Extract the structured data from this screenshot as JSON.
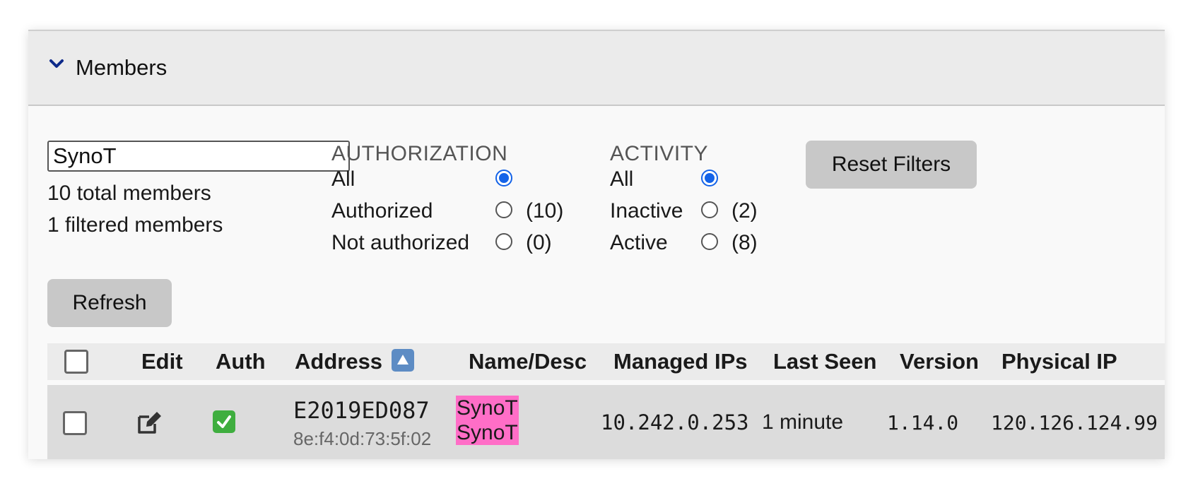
{
  "section": {
    "title": "Members"
  },
  "filter": {
    "value": "SynoT",
    "total_label": "10 total members",
    "filtered_label": "1 filtered members"
  },
  "authorization": {
    "heading": "AUTHORIZATION",
    "options": [
      {
        "label": "All",
        "count": "",
        "selected": true
      },
      {
        "label": "Authorized",
        "count": "(10)",
        "selected": false
      },
      {
        "label": "Not authorized",
        "count": "(0)",
        "selected": false
      }
    ]
  },
  "activity": {
    "heading": "ACTIVITY",
    "options": [
      {
        "label": "All",
        "count": "",
        "selected": true
      },
      {
        "label": "Inactive",
        "count": "(2)",
        "selected": false
      },
      {
        "label": "Active",
        "count": "(8)",
        "selected": false
      }
    ]
  },
  "buttons": {
    "reset": "Reset Filters",
    "refresh": "Refresh"
  },
  "table": {
    "columns": [
      "Edit",
      "Auth",
      "Address",
      "Name/Desc",
      "Managed IPs",
      "Last Seen",
      "Version",
      "Physical IP"
    ],
    "sort_column": "Address",
    "sort_direction": "ascending",
    "rows": [
      {
        "address": "E2019ED087",
        "mac": "8e:f4:0d:73:5f:02",
        "name": "SynoT",
        "desc": "SynoT",
        "managed_ips": "10.242.0.253",
        "last_seen": "1 minute",
        "version": "1.14.0",
        "physical_ip": "120.126.124.99",
        "authorized": true
      }
    ]
  },
  "colors": {
    "radio_selected": "#1463e8",
    "highlight": "#ff6ec7",
    "auth_check": "#3fae3f",
    "header_bg": "#ebebeb",
    "row_bg": "#dcdcdc",
    "button_bg": "#c8c8c8"
  },
  "icons": {
    "collapse": "chevron-down-icon",
    "sort": "sort-ascending-icon",
    "edit": "edit-icon",
    "auth": "checkmark-icon"
  }
}
